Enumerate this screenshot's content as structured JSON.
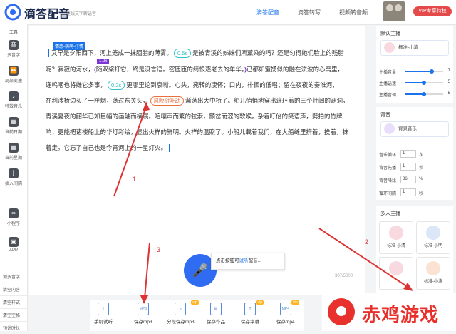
{
  "header": {
    "brand": "滴答配音",
    "brand_sub": "在线文字转语音",
    "tabs": [
      "滴答配音",
      "滴答转写",
      "视频转音频"
    ],
    "vip": "VIP专享特权"
  },
  "left_tools": {
    "section": "工具",
    "items": [
      {
        "label": "多音字",
        "icon": "polyphone-icon",
        "glyph": "音"
      },
      {
        "label": "局部变速",
        "icon": "speed-icon",
        "glyph": "⏩"
      },
      {
        "label": "特效音乐",
        "icon": "music-icon",
        "glyph": "♪"
      },
      {
        "label": "当前日期",
        "icon": "calendar-icon",
        "glyph": "▦"
      },
      {
        "label": "当前星期",
        "icon": "week-icon",
        "glyph": "▦"
      },
      {
        "label": "插入间隔",
        "icon": "gap-icon",
        "glyph": "⫿"
      },
      {
        "label": "小程序",
        "icon": "miniprogram-icon",
        "glyph": "∞"
      },
      {
        "label": "APP",
        "icon": "app-icon",
        "glyph": "▣"
      }
    ],
    "bottom": [
      "测多音字",
      "清空内容",
      "清空样式",
      "清空空格",
      "预计时长"
    ]
  },
  "editor": {
    "tag_voice": "情感-萌萌-抒情",
    "tag_speed": "1.2x",
    "line1_a": "又早是夕阳西下，河上笼成一抹胭脂的薄雾。",
    "pause1": "0.5s",
    "line1_b": "是被青溪的姊妹们所薰染的吗？还是匀得她们脸上的残脂",
    "line2_a": "呢？寂寂的河水，",
    "line2_b": "随双桨打它，终是没言语。密匝匝的绮恨逐老去的年华，",
    "line2_c": "已都如蜜饧似的融在流波的心窝里，",
    "line3_a": "连呜咽也将嫌它多事，",
    "pause2": "0.2s",
    "line3_b": "更哪里论到哀嘶。心头，宛转的凄怀；口内，徘徊的低唱；留在夜夜的秦淮河，",
    "line4_a": "在利涉桥边买了一匣烟，荡过东关头，",
    "poly": "风吹树叶动",
    "line4_b": "渐荡出大中桥了。船儿悄悄地穿出连环着的三个壮阔的涵洞，",
    "line5": "青溪夏夜的韶华已如巨幅的画轴而横展。喧嚷声而繁的弦索，颤岔而涩的歌喉，杂着吁佁的笑语声，劈拍的竹牌",
    "line6": "响，更能把诸楼船上的华灯彩绘，显出火样的鲜明。火样的温煦了。小船儿载着我们，在大船缝里挤着，挨着，抹",
    "line7": "着走。它忘了自己也是今宵河上的一星灯火。",
    "word_count": "307/5000"
  },
  "tip": {
    "prefix": "点击按钮可",
    "highlight": "试听",
    "suffix": "配音..."
  },
  "bottom_bar": [
    {
      "label": "手机试听",
      "icon": "phone-icon",
      "vip": ""
    },
    {
      "label": "保存mp3",
      "icon": "save-mp3-icon",
      "vip": ""
    },
    {
      "label": "分段保存mp3",
      "icon": "split-save-icon",
      "vip": "vip"
    },
    {
      "label": "保存作品",
      "icon": "save-work-icon",
      "vip": ""
    },
    {
      "label": "保存字幕",
      "icon": "subtitle-icon",
      "vip": "vip"
    },
    {
      "label": "保存mp4",
      "icon": "mp4-icon",
      "vip": "vip"
    }
  ],
  "right_panel": {
    "default_title": "默认主播",
    "speaker": "标准-小清",
    "sliders": [
      {
        "label": "主播音量",
        "value": "7",
        "level": 0.7
      },
      {
        "label": "主播语速",
        "value": "5",
        "level": 0.5
      },
      {
        "label": "主播音调",
        "value": "5",
        "level": 0.5
      }
    ],
    "bg_title": "背音",
    "bg_music": "背景音乐",
    "bg_rows": [
      {
        "label": "音乐循环",
        "value": "1",
        "unit": "次"
      },
      {
        "label": "背音先播",
        "value": "1",
        "unit": "秒"
      },
      {
        "label": "背音降比",
        "value": "36",
        "unit": "%"
      },
      {
        "label": "循环间隔",
        "value": "1",
        "unit": "秒"
      }
    ],
    "multi_title": "多人主播",
    "multi": [
      "标准-小清",
      "标准-小明",
      "",
      "标准-小涛"
    ]
  },
  "annotations": [
    "1",
    "2",
    "3"
  ],
  "watermark": "赤鸡游戏"
}
